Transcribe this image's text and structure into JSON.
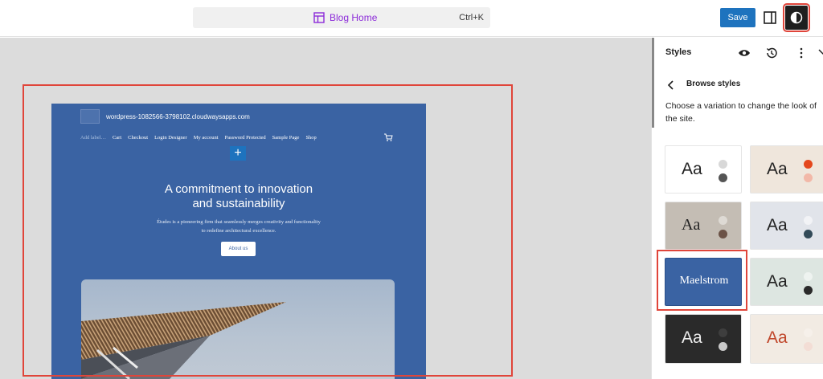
{
  "topbar": {
    "document_title": "Blog Home",
    "shortcut": "Ctrl+K",
    "save_label": "Save"
  },
  "site": {
    "url": "wordpress-1082566-3798102.cloudwaysapps.com",
    "nav": [
      "Add label…",
      "Cart",
      "Checkout",
      "Login Designer",
      "My account",
      "Password Protected",
      "Sample Page",
      "Shop"
    ],
    "hero_title_line1": "A commitment to innovation",
    "hero_title_line2": "and sustainability",
    "hero_text": "Études is a pioneering firm that seamlessly merges creativity and functionality to redefine architectural excellence.",
    "cta": "About us"
  },
  "sidebar": {
    "title": "Styles",
    "subtitle": "Browse styles",
    "description": "Choose a variation to change the look of the site.",
    "variations": [
      {
        "label": "Aa",
        "bg": "#f2f2f2",
        "dots": [
          "#d8d8d8",
          "#555555"
        ],
        "font": "sans"
      },
      {
        "label": "Aa",
        "bg": "#efe6dc",
        "dots": [
          "#e4471d",
          "#f2b8a8"
        ],
        "font": "sans"
      },
      {
        "label": "Aa",
        "bg": "#c4bdb4",
        "dots": [
          "#dedad4",
          "#6b5246"
        ],
        "font": "serif"
      },
      {
        "label": "Aa",
        "bg": "#e1e4ea",
        "dots": [
          "#f2f3f6",
          "#324a58"
        ],
        "font": "sans"
      },
      {
        "label": "Maelstrom",
        "bg": "#3a63a3",
        "dots": [],
        "font": "serif"
      },
      {
        "label": "Aa",
        "bg": "#dde6e1",
        "dots": [
          "#eef3f0",
          "#2a2a2a"
        ],
        "font": "sans"
      },
      {
        "label": "Aa",
        "bg": "#2a2a2a",
        "dots": [
          "#3e3e3e",
          "#c9c9c9"
        ],
        "font": "sans"
      },
      {
        "label": "Aa",
        "bg": "#f2ebe3",
        "dots": [
          "#f6f0ea",
          "#f3ddd5"
        ],
        "font": "sans"
      }
    ]
  },
  "colors": {
    "accent": "#1e73be",
    "highlight": "#e0453a",
    "site_bg": "#3a63a3",
    "title_purple": "#8c2bd9"
  },
  "icons": {
    "template": "template-icon",
    "panel": "sidebar-toggle-icon",
    "styles": "contrast-icon",
    "preview": "eye-icon",
    "revisions": "history-icon",
    "more": "more-vertical-icon",
    "back": "chevron-left-icon",
    "cart": "cart-icon",
    "add": "plus-icon"
  }
}
